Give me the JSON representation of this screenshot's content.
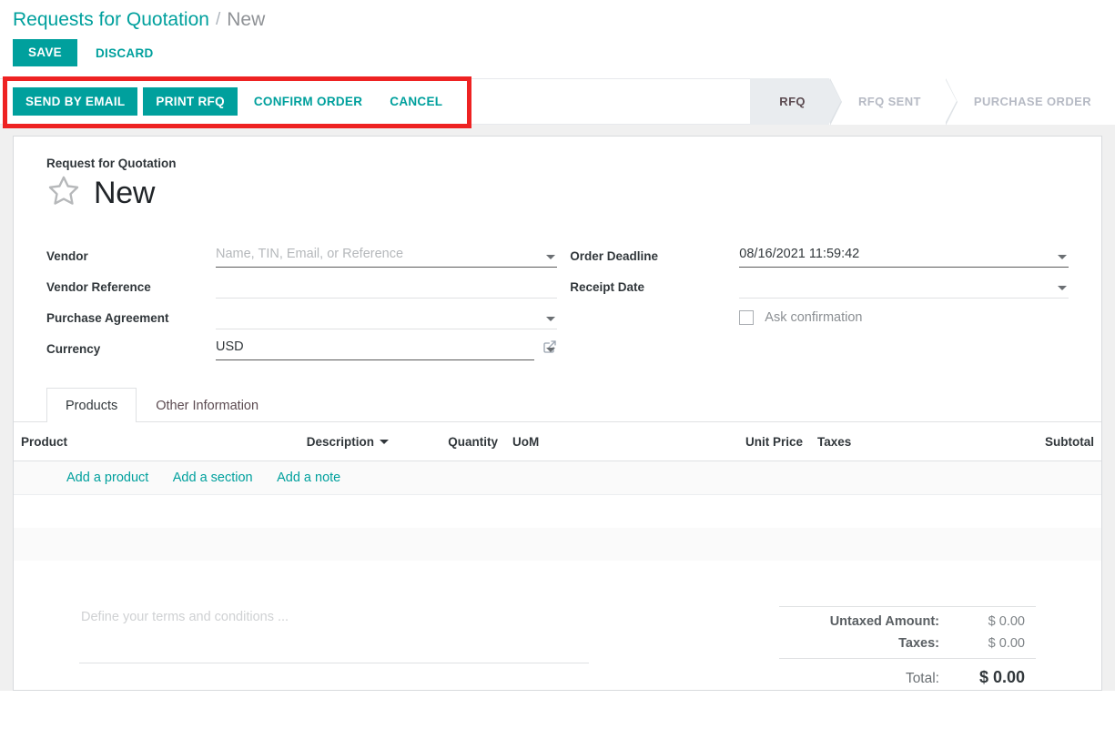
{
  "breadcrumb": {
    "root": "Requests for Quotation",
    "separator": "/",
    "current": "New"
  },
  "savebar": {
    "save_label": "SAVE",
    "discard_label": "DISCARD"
  },
  "actions": {
    "send_by_email": "SEND BY EMAIL",
    "print_rfq": "PRINT RFQ",
    "confirm_order": "CONFIRM ORDER",
    "cancel": "CANCEL"
  },
  "statusbar": {
    "stages": [
      {
        "label": "RFQ",
        "active": true
      },
      {
        "label": "RFQ SENT",
        "active": false
      },
      {
        "label": "PURCHASE ORDER",
        "active": false
      }
    ]
  },
  "form": {
    "subtitle": "Request for Quotation",
    "title": "New",
    "favorite_icon": "star-outline-icon",
    "left_fields": [
      {
        "label": "Vendor",
        "value": "",
        "placeholder": "Name, TIN, Email, or Reference",
        "has_dropdown": true,
        "emphasis": true
      },
      {
        "label": "Vendor Reference",
        "value": "",
        "placeholder": "",
        "has_dropdown": false,
        "emphasis": false
      },
      {
        "label": "Purchase Agreement",
        "value": "",
        "placeholder": "",
        "has_dropdown": true,
        "emphasis": false
      },
      {
        "label": "Currency",
        "value": "USD",
        "placeholder": "",
        "has_dropdown": true,
        "emphasis": true,
        "external_link": true
      }
    ],
    "right_fields": [
      {
        "label": "Order Deadline",
        "value": "08/16/2021 11:59:42",
        "placeholder": "",
        "has_dropdown": true,
        "emphasis": true
      },
      {
        "label": "Receipt Date",
        "value": "",
        "placeholder": "",
        "has_dropdown": true,
        "emphasis": false
      }
    ],
    "checkbox": {
      "label": "Ask confirmation",
      "checked": false
    }
  },
  "notebook": {
    "tabs": [
      {
        "label": "Products",
        "active": true
      },
      {
        "label": "Other Information",
        "active": false
      }
    ]
  },
  "lines_table": {
    "columns": {
      "product": "Product",
      "description": "Description",
      "quantity": "Quantity",
      "uom": "UoM",
      "unit_price": "Unit Price",
      "taxes": "Taxes",
      "subtotal": "Subtotal"
    },
    "sorted_column": "Description",
    "optional_columns_icon": "vertical-dots-icon",
    "rows": [],
    "add_links": {
      "add_product": "Add a product",
      "add_section": "Add a section",
      "add_note": "Add a note"
    }
  },
  "terms": {
    "placeholder": "Define your terms and conditions ..."
  },
  "totals": {
    "untaxed_label": "Untaxed Amount:",
    "untaxed_value": "$ 0.00",
    "taxes_label": "Taxes:",
    "taxes_value": "$ 0.00",
    "total_label": "Total:",
    "total_value": "$ 0.00"
  },
  "colors": {
    "brand_teal": "#00A09D",
    "highlight_red": "#ee2222",
    "sheet_bg": "#ffffff",
    "page_bg": "#f0f0f0",
    "stage_active_bg": "#e9ecef"
  }
}
